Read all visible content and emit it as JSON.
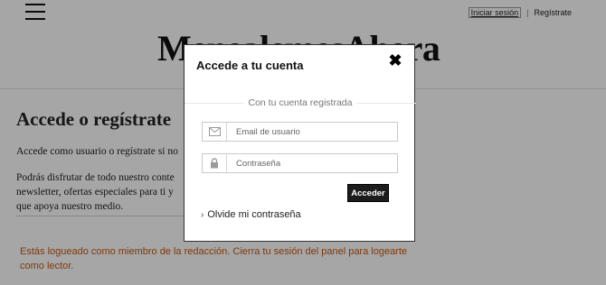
{
  "header": {
    "login_link": "Iniciar sesión",
    "separator": "|",
    "register_link": "Regístrate",
    "logo_text": "MenealemesAhora"
  },
  "main": {
    "heading": "Accede o regístrate",
    "intro_line": "Accede como usuario o regístrate si no",
    "benefits_lines": [
      "Podrás disfrutar de todo nuestro conte",
      "newsletter, ofertas especiales para ti y",
      "que apoya nuestro medio."
    ],
    "warning": "Estás logueado como miembro de la redacción. Cierra tu sesión del panel para logearte como lector."
  },
  "modal": {
    "title": "Accede a tu cuenta",
    "close_symbol": "✖",
    "section_label": "Con tu cuenta registrada",
    "email_placeholder": "Email de usuario",
    "password_placeholder": "Contraseña",
    "submit_label": "Acceder",
    "forgot_chevron": "›",
    "forgot_label": "Olvide mi contraseña"
  },
  "colors": {
    "warning": "#c55a11",
    "button_bg": "#1c1c1c",
    "overlay": "rgba(0,0,0,0.35)"
  },
  "icons": {
    "menu": "hamburger-menu-icon",
    "email": "envelope-icon",
    "password": "lock-icon",
    "close": "close-icon",
    "forgot": "chevron-right-icon"
  }
}
